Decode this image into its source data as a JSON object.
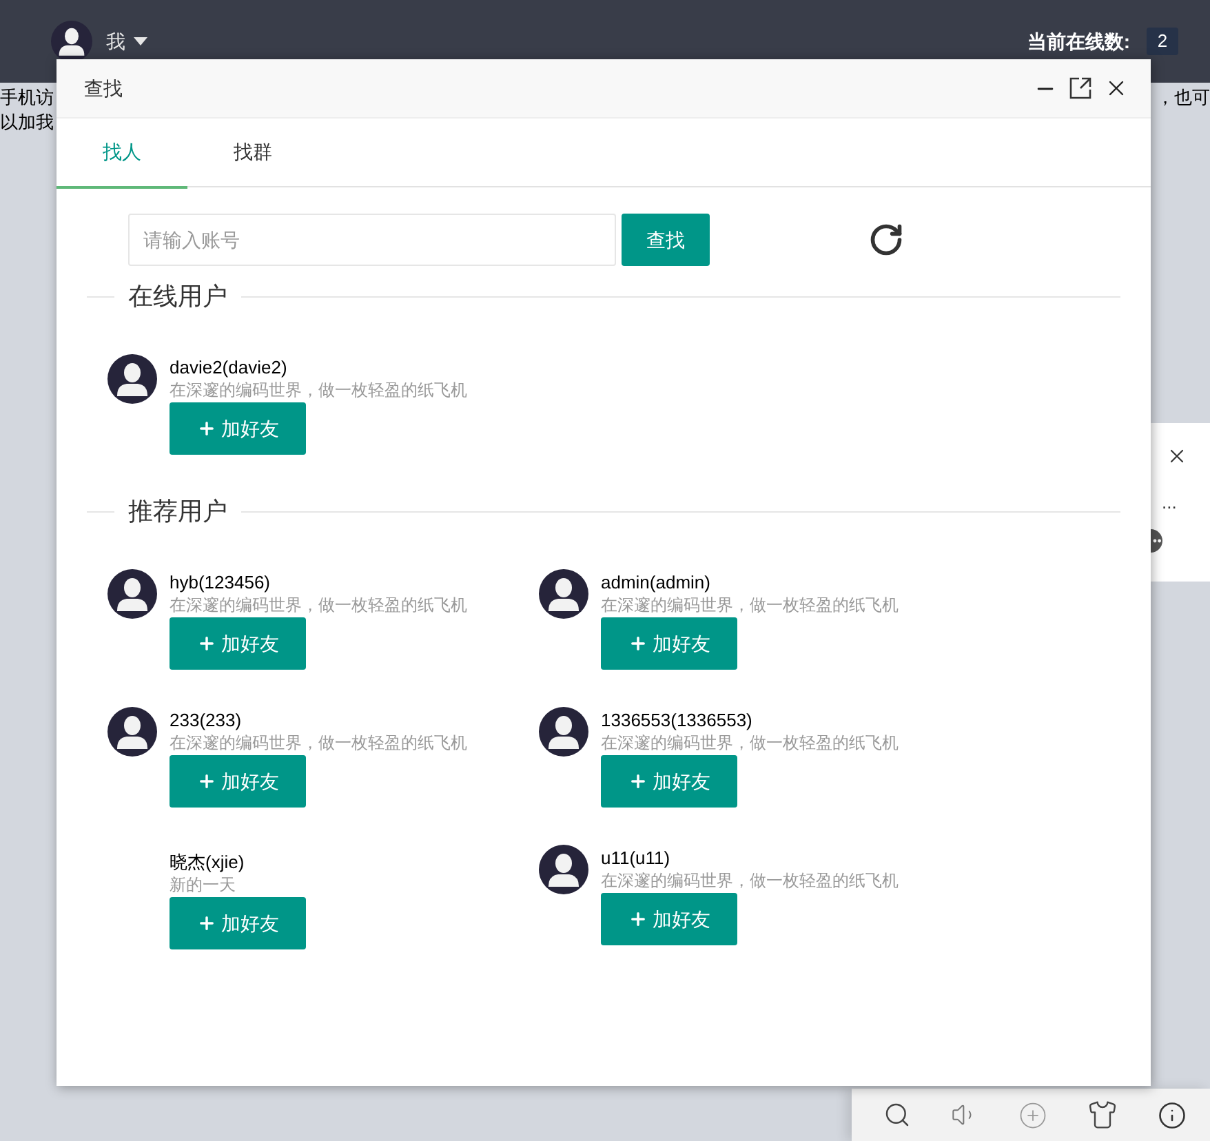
{
  "top_bar": {
    "user_label": "我",
    "online_label": "当前在线数:",
    "online_count": "2"
  },
  "page_text": {
    "left_lines": [
      "手机访",
      "以加我"
    ],
    "right_line": "，也可"
  },
  "dialog": {
    "title": "查找",
    "tabs": [
      {
        "label": "找人",
        "selected": true
      },
      {
        "label": "找群",
        "selected": false
      }
    ],
    "search": {
      "placeholder": "请输入账号",
      "button": "查找"
    },
    "sections": [
      {
        "title": "在线用户",
        "users": [
          {
            "name": "davie2(davie2)",
            "signature": "在深邃的编码世界，做一枚轻盈的纸飞机",
            "has_avatar": true,
            "add_button": "加好友"
          }
        ]
      },
      {
        "title": "推荐用户",
        "users": [
          {
            "name": "hyb(123456)",
            "signature": "在深邃的编码世界，做一枚轻盈的纸飞机",
            "has_avatar": true,
            "add_button": "加好友"
          },
          {
            "name": "admin(admin)",
            "signature": "在深邃的编码世界，做一枚轻盈的纸飞机",
            "has_avatar": true,
            "add_button": "加好友"
          },
          {
            "name": "233(233)",
            "signature": "在深邃的编码世界，做一枚轻盈的纸飞机",
            "has_avatar": true,
            "add_button": "加好友"
          },
          {
            "name": "1336553(1336553)",
            "signature": "在深邃的编码世界，做一枚轻盈的纸飞机",
            "has_avatar": true,
            "add_button": "加好友"
          },
          {
            "name": "晓杰(xjie)",
            "signature": "新的一天",
            "has_avatar": false,
            "add_button": "加好友"
          },
          {
            "name": "u11(u11)",
            "signature": "在深邃的编码世界，做一枚轻盈的纸飞机",
            "has_avatar": true,
            "add_button": "加好友"
          }
        ]
      }
    ]
  },
  "side_panel": {
    "text": "..."
  }
}
